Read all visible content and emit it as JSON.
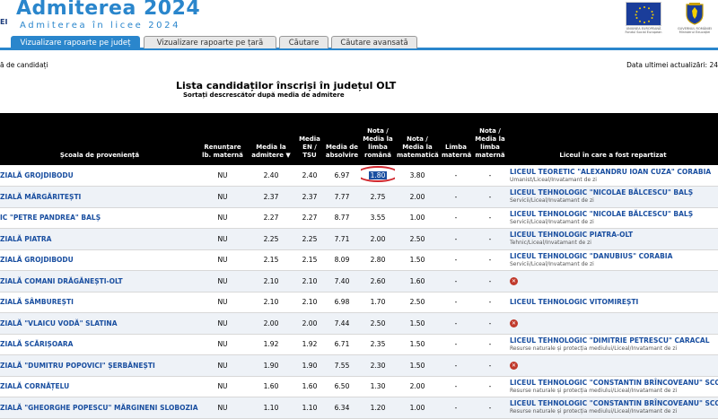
{
  "header": {
    "ei": "EI",
    "title": "Admiterea 2024",
    "subtitle": "Admiterea în licee 2024",
    "eu_caption": "UNIUNEA EUROPEANĂ Fondul Social European",
    "gov_caption": "GUVERNUL ROMÂNIEI Ministerul Educației"
  },
  "tabs": [
    {
      "label": "Vizualizare rapoarte pe județ",
      "active": true
    },
    {
      "label": "Vizualizare rapoarte pe țară",
      "active": false
    },
    {
      "label": "Căutare",
      "active": false
    },
    {
      "label": "Căutare avansată",
      "active": false
    }
  ],
  "info": {
    "left": "ă de candidați",
    "right": "Data ultimei actualizări: 24"
  },
  "list": {
    "title": "Lista candidaților înscriși în județul OLT",
    "subtitle": "Sortați descrescător după media de admitere"
  },
  "columns": {
    "school": "Școala de proveniență",
    "renuntare": "Renunțare lb. maternă",
    "media_adm": "Media la admitere ▼",
    "media_en": "Media EN / TSU",
    "media_abs": "Media de absolvire",
    "nota_ro": "Nota / Media la limba română",
    "nota_mat": "Nota / Media la matematică",
    "limba_mat": "Limba maternă",
    "nota_lm": "Nota / Media la limba maternă",
    "liceu": "Liceul în care a fost repartizat"
  },
  "rows": [
    {
      "school": "ZIALĂ GROJDIBODU",
      "ren": "NU",
      "adm": "2.40",
      "en": "2.40",
      "abs": "6.97",
      "ro": "1.80",
      "mat": "3.80",
      "lm": "-",
      "nlm": "-",
      "lic": "LICEUL TEORETIC \"ALEXANDRU IOAN CUZA\" CORABIA",
      "spec": "Umanist/Liceal/Invatamant de zi",
      "highlight": true
    },
    {
      "school": "ZIALĂ MĂRGĂRITEȘTI",
      "ren": "NU",
      "adm": "2.37",
      "en": "2.37",
      "abs": "7.77",
      "ro": "2.75",
      "mat": "2.00",
      "lm": "-",
      "nlm": "-",
      "lic": "LICEUL TEHNOLOGIC \"NICOLAE BĂLCESCU\" BALȘ",
      "spec": "Servicii/Liceal/Invatamant de zi"
    },
    {
      "school": "IC \"PETRE PANDREA\" BALȘ",
      "ren": "NU",
      "adm": "2.27",
      "en": "2.27",
      "abs": "8.77",
      "ro": "3.55",
      "mat": "1.00",
      "lm": "-",
      "nlm": "-",
      "lic": "LICEUL TEHNOLOGIC \"NICOLAE BĂLCESCU\" BALȘ",
      "spec": "Servicii/Liceal/Invatamant de zi"
    },
    {
      "school": "ZIALĂ PIATRA",
      "ren": "NU",
      "adm": "2.25",
      "en": "2.25",
      "abs": "7.71",
      "ro": "2.00",
      "mat": "2.50",
      "lm": "-",
      "nlm": "-",
      "lic": "LICEUL TEHNOLOGIC PIATRA-OLT",
      "spec": "Tehnic/Liceal/Invatamant de zi"
    },
    {
      "school": "ZIALĂ GROJDIBODU",
      "ren": "NU",
      "adm": "2.15",
      "en": "2.15",
      "abs": "8.09",
      "ro": "2.80",
      "mat": "1.50",
      "lm": "-",
      "nlm": "-",
      "lic": "LICEUL TEHNOLOGIC \"DANUBIUS\" CORABIA",
      "spec": "Servicii/Liceal/Invatamant de zi"
    },
    {
      "school": "ZIALĂ COMANI DRĂGĂNEȘTI-OLT",
      "ren": "NU",
      "adm": "2.10",
      "en": "2.10",
      "abs": "7.40",
      "ro": "2.60",
      "mat": "1.60",
      "lm": "-",
      "nlm": "-",
      "lic": "",
      "spec": "",
      "x": true
    },
    {
      "school": "ZIALĂ SÂMBUREȘTI",
      "ren": "NU",
      "adm": "2.10",
      "en": "2.10",
      "abs": "6.98",
      "ro": "1.70",
      "mat": "2.50",
      "lm": "-",
      "nlm": "-",
      "lic": "LICEUL TEHNOLOGIC VITOMIREȘTI",
      "spec": ""
    },
    {
      "school": "ZIALĂ \"VLAICU VODĂ\" SLATINA",
      "ren": "NU",
      "adm": "2.00",
      "en": "2.00",
      "abs": "7.44",
      "ro": "2.50",
      "mat": "1.50",
      "lm": "-",
      "nlm": "-",
      "lic": "",
      "spec": "",
      "x": true
    },
    {
      "school": "ZIALĂ SCĂRIȘOARA",
      "ren": "NU",
      "adm": "1.92",
      "en": "1.92",
      "abs": "6.71",
      "ro": "2.35",
      "mat": "1.50",
      "lm": "-",
      "nlm": "-",
      "lic": "LICEUL TEHNOLOGIC \"DIMITRIE PETRESCU\" CARACAL",
      "spec": "Resurse naturale și protecția mediului/Liceal/Invatamant de zi"
    },
    {
      "school": "ZIALĂ \"DUMITRU POPOVICI\" ȘERBĂNEȘTI",
      "ren": "NU",
      "adm": "1.90",
      "en": "1.90",
      "abs": "7.55",
      "ro": "2.30",
      "mat": "1.50",
      "lm": "-",
      "nlm": "-",
      "lic": "",
      "spec": "",
      "x": true
    },
    {
      "school": "ZIALĂ CORNĂȚELU",
      "ren": "NU",
      "adm": "1.60",
      "en": "1.60",
      "abs": "6.50",
      "ro": "1.30",
      "mat": "2.00",
      "lm": "-",
      "nlm": "-",
      "lic": "LICEUL TEHNOLOGIC \"CONSTANTIN BRÎNCOVEANU\" SCO",
      "spec": "Resurse naturale și protecția mediului/Liceal/Invatamant de zi"
    },
    {
      "school": "ZIALĂ \"GHEORGHE POPESCU\" MĂRGINENI SLOBOZIA",
      "ren": "NU",
      "adm": "1.10",
      "en": "1.10",
      "abs": "6.34",
      "ro": "1.20",
      "mat": "1.00",
      "lm": "-",
      "nlm": "-",
      "lic": "LICEUL TEHNOLOGIC \"CONSTANTIN BRÎNCOVEANU\" SCO",
      "spec": "Resurse naturale și protecția mediului/Liceal/Invatamant de zi"
    }
  ]
}
